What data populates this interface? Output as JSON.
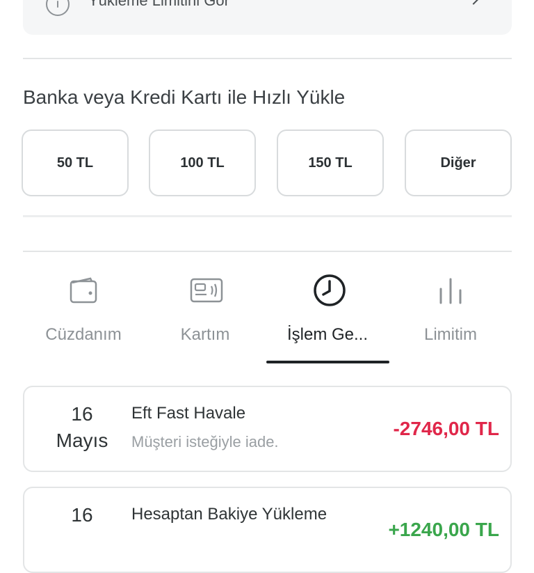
{
  "limit_card": {
    "label": "Yükleme Limitini Gör"
  },
  "quick_load": {
    "title": "Banka veya Kredi Kartı ile Hızlı Yükle",
    "amounts": [
      "50 TL",
      "100 TL",
      "150 TL",
      "Diğer"
    ]
  },
  "tabs": [
    {
      "label": "Cüzdanım",
      "icon": "wallet-icon",
      "active": false
    },
    {
      "label": "Kartım",
      "icon": "card-icon",
      "active": false
    },
    {
      "label": "İşlem Ge...",
      "icon": "clock-icon",
      "active": true
    },
    {
      "label": "Limitim",
      "icon": "bars-icon",
      "active": false
    }
  ],
  "transactions": [
    {
      "day": "16",
      "month": "Mayıs",
      "title": "Eft Fast Havale",
      "desc": "Müşteri isteğiyle iade.",
      "amount": "-2746,00 TL",
      "type": "negative"
    },
    {
      "day": "16",
      "month": "",
      "title": "Hesaptan Bakiye Yükleme",
      "desc": "",
      "amount": "+1240,00 TL",
      "type": "positive"
    }
  ],
  "colors": {
    "negative": "#e0274a",
    "positive": "#3aa64c",
    "active_tab": "#1f2326",
    "inactive_tab": "#8d9296"
  }
}
